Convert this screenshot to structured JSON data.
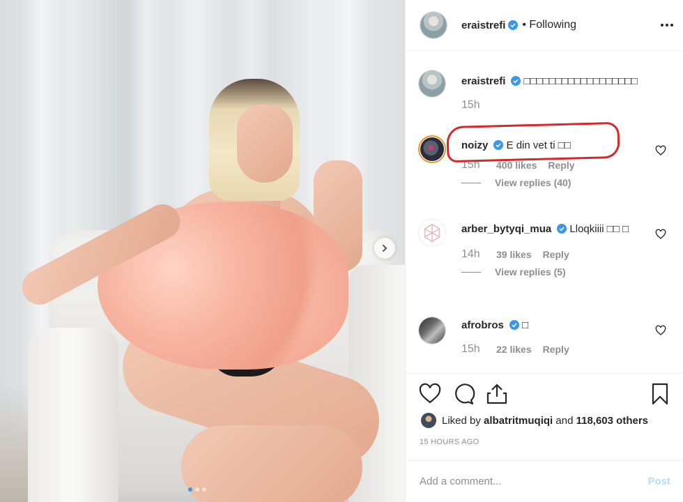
{
  "header": {
    "username": "eraistrefi",
    "following_label": "• Following"
  },
  "colors": {
    "accent": "#3897f0",
    "highlight": "#d6272b",
    "muted": "#8e8e8e",
    "post_disabled": "#b2dffc"
  },
  "caption": {
    "username": "eraistrefi",
    "text": "□□□□□□□□□□□□□□□□□□",
    "time": "15h"
  },
  "comments": [
    {
      "username": "noizy",
      "text": "E din vet ti □□",
      "time": "15h",
      "likes": "400 likes",
      "reply": "Reply",
      "view_replies": "View replies (40)"
    },
    {
      "username": "arber_bytyqi_mua",
      "text": "Lloqkiiii □□ □",
      "time": "14h",
      "likes": "39 likes",
      "reply": "Reply",
      "view_replies": "View replies (5)"
    },
    {
      "username": "afrobros",
      "text": "□",
      "time": "15h",
      "likes": "22 likes",
      "reply": "Reply"
    }
  ],
  "liked_by": {
    "prefix": "Liked by",
    "user": "albatritmuqiqi",
    "conj": "and",
    "others": "118,603 others"
  },
  "timestamp": "15 HOURS AGO",
  "add_comment": {
    "placeholder": "Add a comment...",
    "post_label": "Post"
  },
  "carousel": {
    "slides": 3,
    "active": 1
  },
  "icons": [
    "chevron-right-icon",
    "more-icon",
    "verified-icon",
    "heart-icon",
    "comment-icon",
    "share-icon",
    "bookmark-icon"
  ]
}
